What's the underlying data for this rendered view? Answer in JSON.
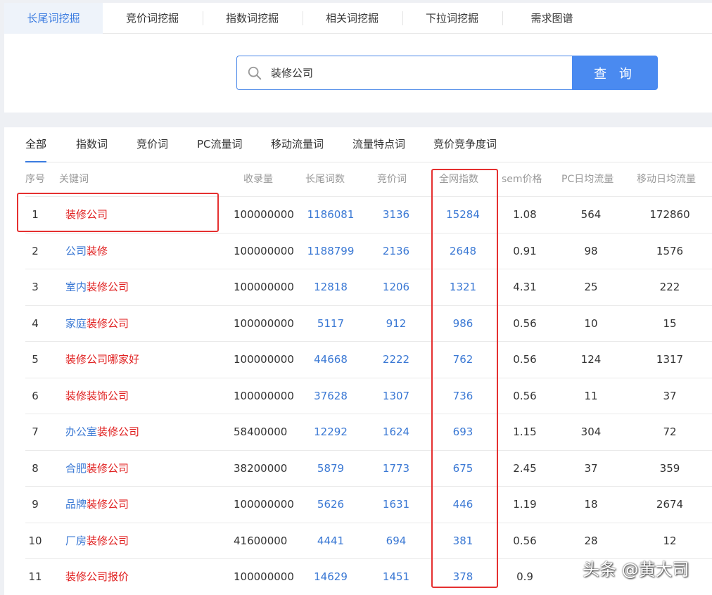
{
  "top_tabs": [
    "长尾词挖掘",
    "竞价词挖掘",
    "指数词挖掘",
    "相关词挖掘",
    "下拉词挖掘",
    "需求图谱"
  ],
  "search": {
    "value": "装修公司",
    "button_label": "查 询"
  },
  "filter_tabs": [
    "全部",
    "指数词",
    "竞价词",
    "PC流量词",
    "移动流量词",
    "流量特点词",
    "竞价竞争度词"
  ],
  "columns": [
    "序号",
    "关键词",
    "收录量",
    "长尾词数",
    "竞价词",
    "全网指数",
    "sem价格",
    "PC日均流量",
    "移动日均流量"
  ],
  "rows": [
    {
      "idx": "1",
      "kw_prefix": "",
      "kw_highlight": "装修公司",
      "kw_suffix": "",
      "shoulu": "100000000",
      "changwei": "1186081",
      "jingjia": "3136",
      "zhishu": "15284",
      "sem": "1.08",
      "pc": "564",
      "mobile": "172860"
    },
    {
      "idx": "2",
      "kw_prefix": "公司",
      "kw_highlight": "装修",
      "kw_suffix": "",
      "shoulu": "100000000",
      "changwei": "1188799",
      "jingjia": "2136",
      "zhishu": "2648",
      "sem": "0.91",
      "pc": "98",
      "mobile": "1576"
    },
    {
      "idx": "3",
      "kw_prefix": "室内",
      "kw_highlight": "装修公司",
      "kw_suffix": "",
      "shoulu": "100000000",
      "changwei": "12818",
      "jingjia": "1206",
      "zhishu": "1321",
      "sem": "4.31",
      "pc": "25",
      "mobile": "222"
    },
    {
      "idx": "4",
      "kw_prefix": "家庭",
      "kw_highlight": "装修公司",
      "kw_suffix": "",
      "shoulu": "100000000",
      "changwei": "5117",
      "jingjia": "912",
      "zhishu": "986",
      "sem": "0.56",
      "pc": "10",
      "mobile": "15"
    },
    {
      "idx": "5",
      "kw_prefix": "",
      "kw_highlight": "装修公司",
      "kw_suffix": "哪家好",
      "shoulu": "100000000",
      "changwei": "44668",
      "jingjia": "2222",
      "zhishu": "762",
      "sem": "0.56",
      "pc": "124",
      "mobile": "1317"
    },
    {
      "idx": "6",
      "kw_prefix": "",
      "kw_highlight": "装修",
      "kw_suffix": "装饰公司",
      "shoulu": "100000000",
      "changwei": "37628",
      "jingjia": "1307",
      "zhishu": "736",
      "sem": "0.56",
      "pc": "11",
      "mobile": "37"
    },
    {
      "idx": "7",
      "kw_prefix": "办公室",
      "kw_highlight": "装修公司",
      "kw_suffix": "",
      "shoulu": "58400000",
      "changwei": "12292",
      "jingjia": "1624",
      "zhishu": "693",
      "sem": "1.15",
      "pc": "304",
      "mobile": "72"
    },
    {
      "idx": "8",
      "kw_prefix": "合肥",
      "kw_highlight": "装修公司",
      "kw_suffix": "",
      "shoulu": "38200000",
      "changwei": "5879",
      "jingjia": "1773",
      "zhishu": "675",
      "sem": "2.45",
      "pc": "37",
      "mobile": "359"
    },
    {
      "idx": "9",
      "kw_prefix": "品牌",
      "kw_highlight": "装修公司",
      "kw_suffix": "",
      "shoulu": "100000000",
      "changwei": "5626",
      "jingjia": "1631",
      "zhishu": "446",
      "sem": "1.19",
      "pc": "18",
      "mobile": "2674"
    },
    {
      "idx": "10",
      "kw_prefix": "厂房",
      "kw_highlight": "装修公司",
      "kw_suffix": "",
      "shoulu": "41600000",
      "changwei": "4441",
      "jingjia": "694",
      "zhishu": "381",
      "sem": "0.56",
      "pc": "28",
      "mobile": "12"
    },
    {
      "idx": "11",
      "kw_prefix": "",
      "kw_highlight": "装修公司",
      "kw_suffix": "报价",
      "shoulu": "100000000",
      "changwei": "14629",
      "jingjia": "1451",
      "zhishu": "378",
      "sem": "0.9",
      "pc": "",
      "mobile": ""
    }
  ],
  "watermark": "头条 @黄大司",
  "colors": {
    "accent": "#4a8af0",
    "link": "#3a78d4",
    "highlight": "#e02020",
    "annotation": "#e53030"
  }
}
